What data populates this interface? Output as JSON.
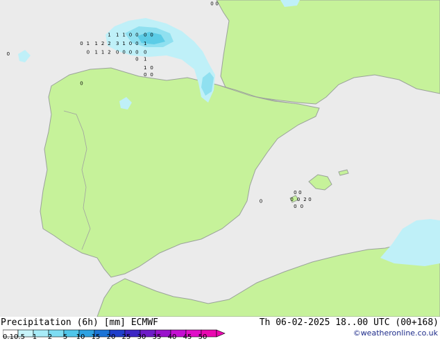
{
  "colors": {
    "sea": "#ebebeb",
    "land": "#c6f29a",
    "coast": "#9aa29a",
    "border": "#a0a0a0",
    "precip_light": "#bff0f8",
    "precip_mid": "#8fe0f0",
    "precip_strong": "#5ccce6"
  },
  "footer": {
    "title": "Precipitation (6h) [mm] ECMWF",
    "valid_time": "Th 06-02-2025 18..00 UTC (00+168)",
    "credit": "©weatheronline.co.uk"
  },
  "legend": {
    "ticks": [
      "0.1",
      "0.5",
      "1",
      "2",
      "5",
      "10",
      "15",
      "20",
      "25",
      "30",
      "35",
      "40",
      "45",
      "50"
    ],
    "colors": [
      "#ffffff",
      "#c8f4fa",
      "#a8ecf8",
      "#7ddcf2",
      "#50c6ea",
      "#2ea2e2",
      "#1b74d6",
      "#1f3fcc",
      "#3c26c4",
      "#6e1cc8",
      "#9a12cc",
      "#c40ed2",
      "#e00ec8",
      "#ea08b0"
    ]
  },
  "precip_labels": [
    {
      "text": "1",
      "lon": -3.6,
      "lat": 46.0
    },
    {
      "text": "1",
      "lon": -3.1,
      "lat": 46.0
    },
    {
      "text": "1",
      "lon": -2.7,
      "lat": 46.0
    },
    {
      "text": "0",
      "lon": -2.3,
      "lat": 46.0
    },
    {
      "text": "0",
      "lon": -1.9,
      "lat": 46.0
    },
    {
      "text": "0",
      "lon": -1.4,
      "lat": 46.0
    },
    {
      "text": "0",
      "lon": -1.0,
      "lat": 46.0
    },
    {
      "text": "0",
      "lon": -5.3,
      "lat": 45.5
    },
    {
      "text": "1",
      "lon": -4.9,
      "lat": 45.5
    },
    {
      "text": "1",
      "lon": -4.4,
      "lat": 45.5
    },
    {
      "text": "2",
      "lon": -4.0,
      "lat": 45.5
    },
    {
      "text": "2",
      "lon": -3.6,
      "lat": 45.5
    },
    {
      "text": "3",
      "lon": -3.1,
      "lat": 45.5
    },
    {
      "text": "1",
      "lon": -2.7,
      "lat": 45.5
    },
    {
      "text": "0",
      "lon": -2.3,
      "lat": 45.5
    },
    {
      "text": "0",
      "lon": -1.9,
      "lat": 45.5
    },
    {
      "text": "1",
      "lon": -1.4,
      "lat": 45.5
    },
    {
      "text": "0",
      "lon": -4.9,
      "lat": 45.0
    },
    {
      "text": "1",
      "lon": -4.4,
      "lat": 45.0
    },
    {
      "text": "1",
      "lon": -4.0,
      "lat": 45.0
    },
    {
      "text": "2",
      "lon": -3.6,
      "lat": 45.0
    },
    {
      "text": "0",
      "lon": -3.1,
      "lat": 45.0
    },
    {
      "text": "0",
      "lon": -2.7,
      "lat": 45.0
    },
    {
      "text": "0",
      "lon": -2.3,
      "lat": 45.0
    },
    {
      "text": "0",
      "lon": -1.9,
      "lat": 45.0
    },
    {
      "text": "0",
      "lon": -1.4,
      "lat": 45.0
    },
    {
      "text": "0",
      "lon": -1.9,
      "lat": 44.6
    },
    {
      "text": "1",
      "lon": -1.4,
      "lat": 44.6
    },
    {
      "text": "1",
      "lon": -1.4,
      "lat": 44.1
    },
    {
      "text": "0",
      "lon": -1.0,
      "lat": 44.1
    },
    {
      "text": "0",
      "lon": -1.4,
      "lat": 43.7
    },
    {
      "text": "0",
      "lon": -1.0,
      "lat": 43.7
    },
    {
      "text": "0",
      "lon": -9.8,
      "lat": 44.9
    },
    {
      "text": "0",
      "lon": -5.3,
      "lat": 43.2
    },
    {
      "text": "0",
      "lon": 2.7,
      "lat": 47.8
    },
    {
      "text": "0",
      "lon": 3.0,
      "lat": 47.8
    },
    {
      "text": "0",
      "lon": 7.8,
      "lat": 36.9
    },
    {
      "text": "0",
      "lon": 8.1,
      "lat": 36.9
    },
    {
      "text": "0",
      "lon": 7.6,
      "lat": 36.5
    },
    {
      "text": "0",
      "lon": 8.0,
      "lat": 36.5
    },
    {
      "text": "2",
      "lon": 8.4,
      "lat": 36.5
    },
    {
      "text": "0",
      "lon": 8.7,
      "lat": 36.5
    },
    {
      "text": "0",
      "lon": 7.8,
      "lat": 36.1
    },
    {
      "text": "0",
      "lon": 8.2,
      "lat": 36.1
    },
    {
      "text": "0",
      "lon": 5.7,
      "lat": 36.4
    }
  ]
}
